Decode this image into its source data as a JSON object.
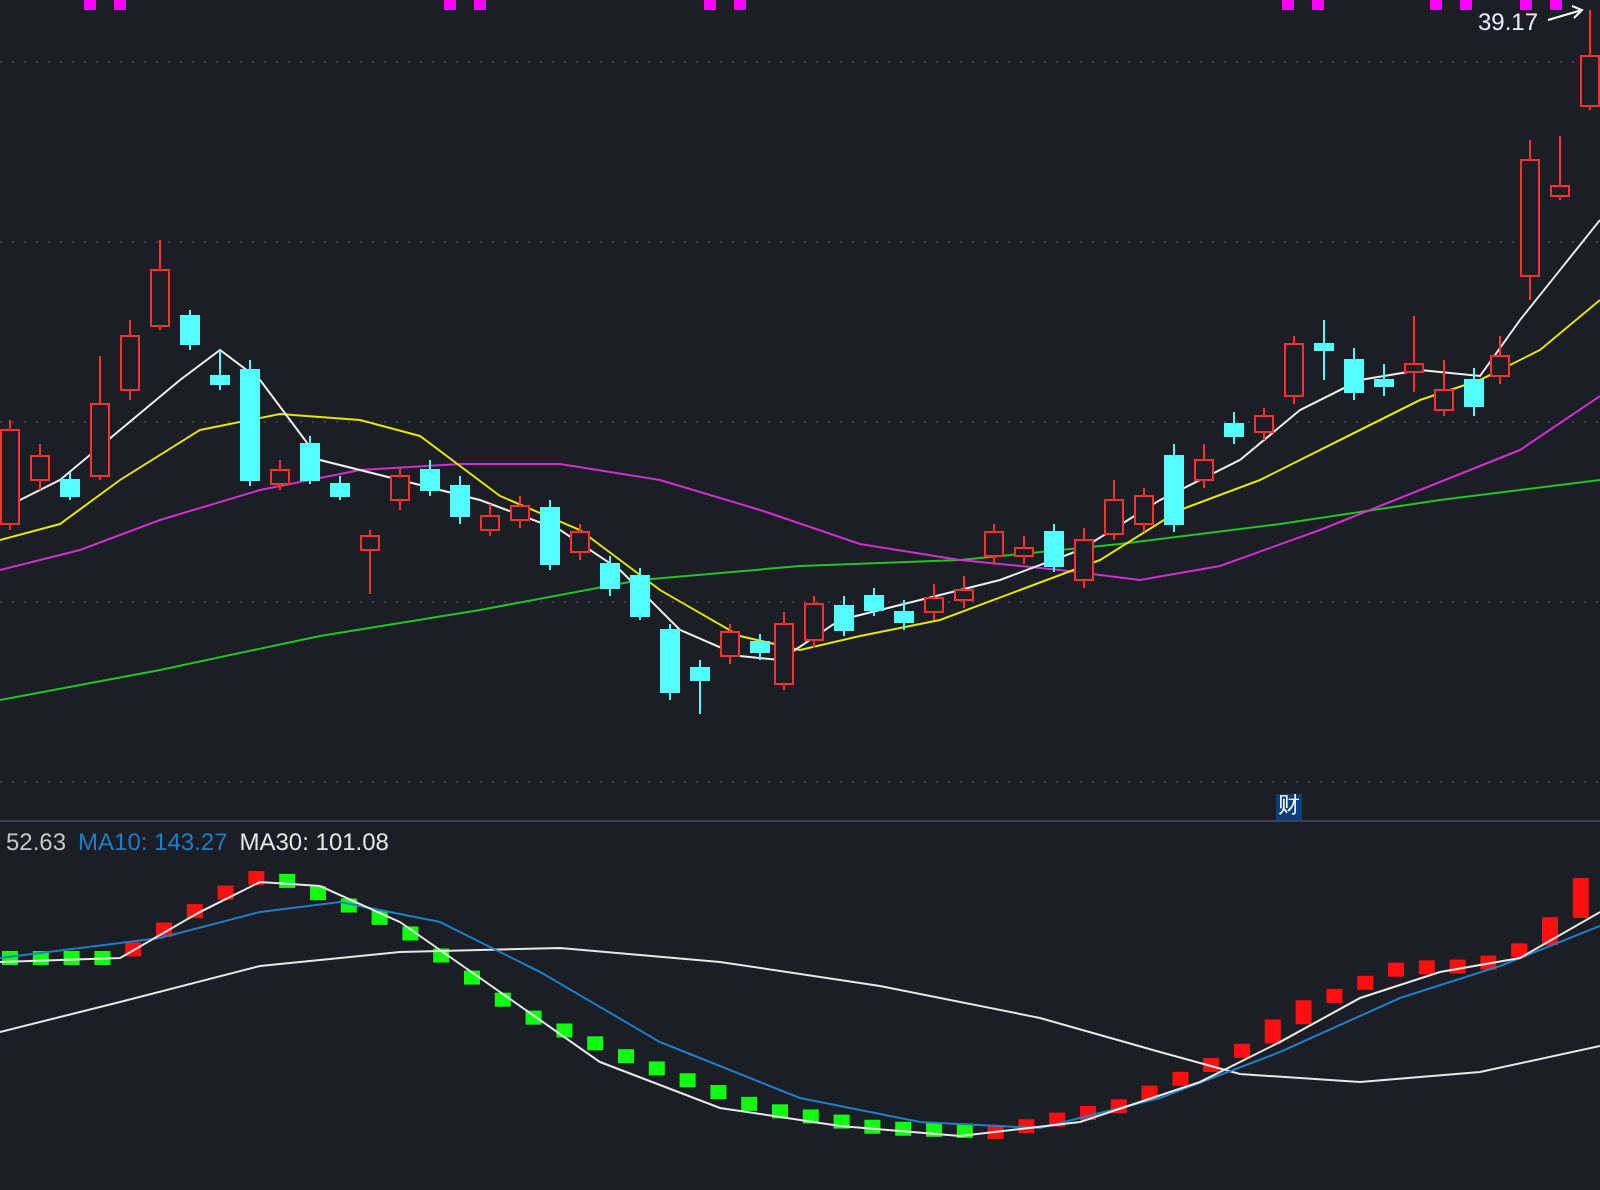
{
  "price_chart": {
    "high_label": "39.17",
    "finance_marker": "财"
  },
  "indicator": {
    "legend": [
      {
        "text": "52.63",
        "color": "#c8c8c8"
      },
      {
        "text": "MA10: 143.27",
        "color": "#1e7fc8"
      },
      {
        "text": "MA30: 101.08",
        "color": "#e6e6e6"
      }
    ]
  }
}
